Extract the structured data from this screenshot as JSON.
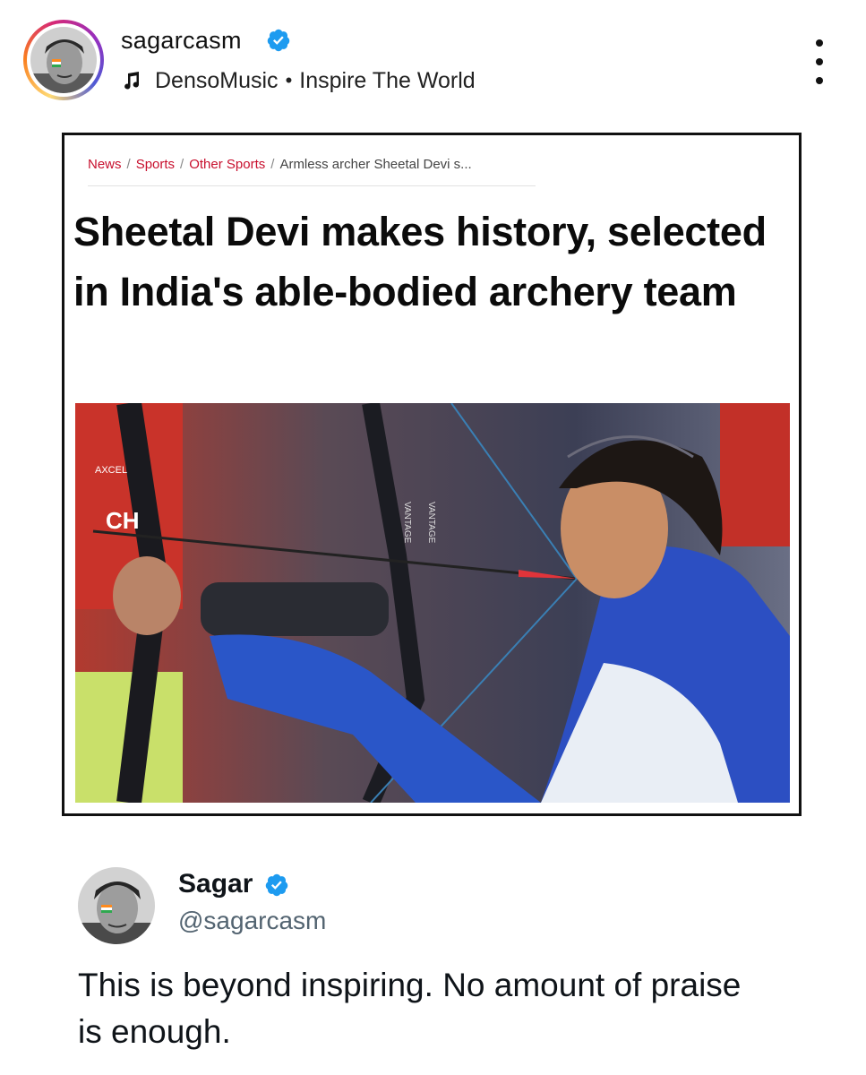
{
  "post": {
    "username": "sagarcasm",
    "verified": true,
    "music": {
      "artist": "DensoMusic",
      "separator": "•",
      "track": "Inspire The World"
    },
    "more_icon": "three-dots-vertical-icon"
  },
  "article": {
    "breadcrumb": [
      "News",
      "Sports",
      "Other Sports",
      "Armless archer Sheetal Devi s..."
    ],
    "breadcrumb_separator": "/",
    "headline": "Sheetal Devi makes history, selected in India's able-bodied archery team",
    "photo_caption_text": [
      "AXCEL",
      "VANTAGE",
      "VANTAGE",
      "CH"
    ]
  },
  "tweet": {
    "display_name": "Sagar",
    "verified": true,
    "handle": "@sagarcasm",
    "text": "This is beyond inspiring. No amount of praise is enough."
  },
  "colors": {
    "verified_blue": "#1d9bf0",
    "breadcrumb_red": "#c8102e",
    "handle_grey": "#536471"
  }
}
